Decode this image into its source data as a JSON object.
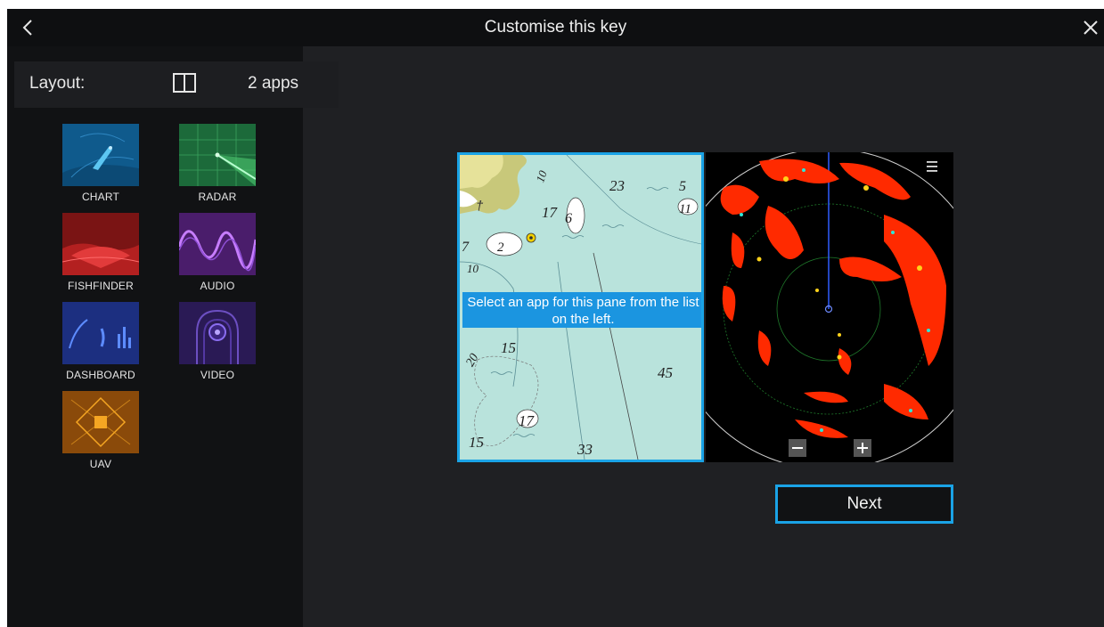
{
  "header": {
    "title": "Customise this key"
  },
  "layout": {
    "label": "Layout:",
    "value": "2 apps"
  },
  "apps": [
    {
      "label": "CHART"
    },
    {
      "label": "RADAR"
    },
    {
      "label": "FISHFINDER"
    },
    {
      "label": "AUDIO"
    },
    {
      "label": "DASHBOARD"
    },
    {
      "label": "VIDEO"
    },
    {
      "label": "UAV"
    }
  ],
  "preview": {
    "message": "Select an app for this pane from the list on the left.",
    "chart_depths": [
      "23",
      "5",
      "11",
      "17",
      "6",
      "7",
      "2",
      "10",
      "15",
      "20",
      "45",
      "17",
      "15",
      "33",
      "10"
    ]
  },
  "actions": {
    "next_label": "Next"
  },
  "colors": {
    "accent": "#1aa3e6",
    "message_bg": "#1b95e0",
    "radar_return": "#ff2a00",
    "chart_water": "#b9e3dc"
  }
}
